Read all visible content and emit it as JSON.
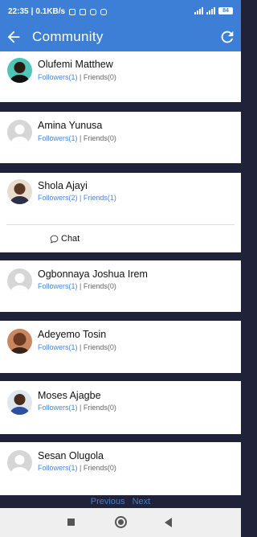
{
  "status_bar": {
    "time": "22:35",
    "speed": "0.1KB/s",
    "battery": "84"
  },
  "app_bar": {
    "title": "Community"
  },
  "users": [
    {
      "name": "Olufemi Matthew",
      "followers": "Followers(1)",
      "sep": "|",
      "friends": "Friends(0)"
    },
    {
      "name": "Amina Yunusa",
      "followers": "Followers(1)",
      "sep": "|",
      "friends": "Friends(0)"
    },
    {
      "name": "Shola Ajayi",
      "followers": "Followers(2)",
      "sep": "|",
      "friends": "Friends(1)",
      "chat": "Chat"
    },
    {
      "name": "Ogbonnaya Joshua Irem",
      "followers": "Followers(1)",
      "sep": "|",
      "friends": "Friends(0)"
    },
    {
      "name": "Adeyemo Tosin",
      "followers": "Followers(1)",
      "sep": "|",
      "friends": "Friends(0)"
    },
    {
      "name": "Moses Ajagbe",
      "followers": "Followers(1)",
      "sep": "|",
      "friends": "Friends(0)"
    },
    {
      "name": "Sesan Olugola",
      "followers": "Followers(1)",
      "sep": "|",
      "friends": "Friends(0)"
    }
  ],
  "pager": {
    "previous": "Previous",
    "next": "Next"
  },
  "icons": {
    "back": "arrow-back-icon",
    "refresh": "refresh-icon",
    "chat": "chat-bubble-icon",
    "avatar_placeholder": "default-avatar-icon"
  },
  "colors": {
    "primary": "#3d7fd6",
    "separator": "#1f2238",
    "link": "#4a86d4"
  }
}
